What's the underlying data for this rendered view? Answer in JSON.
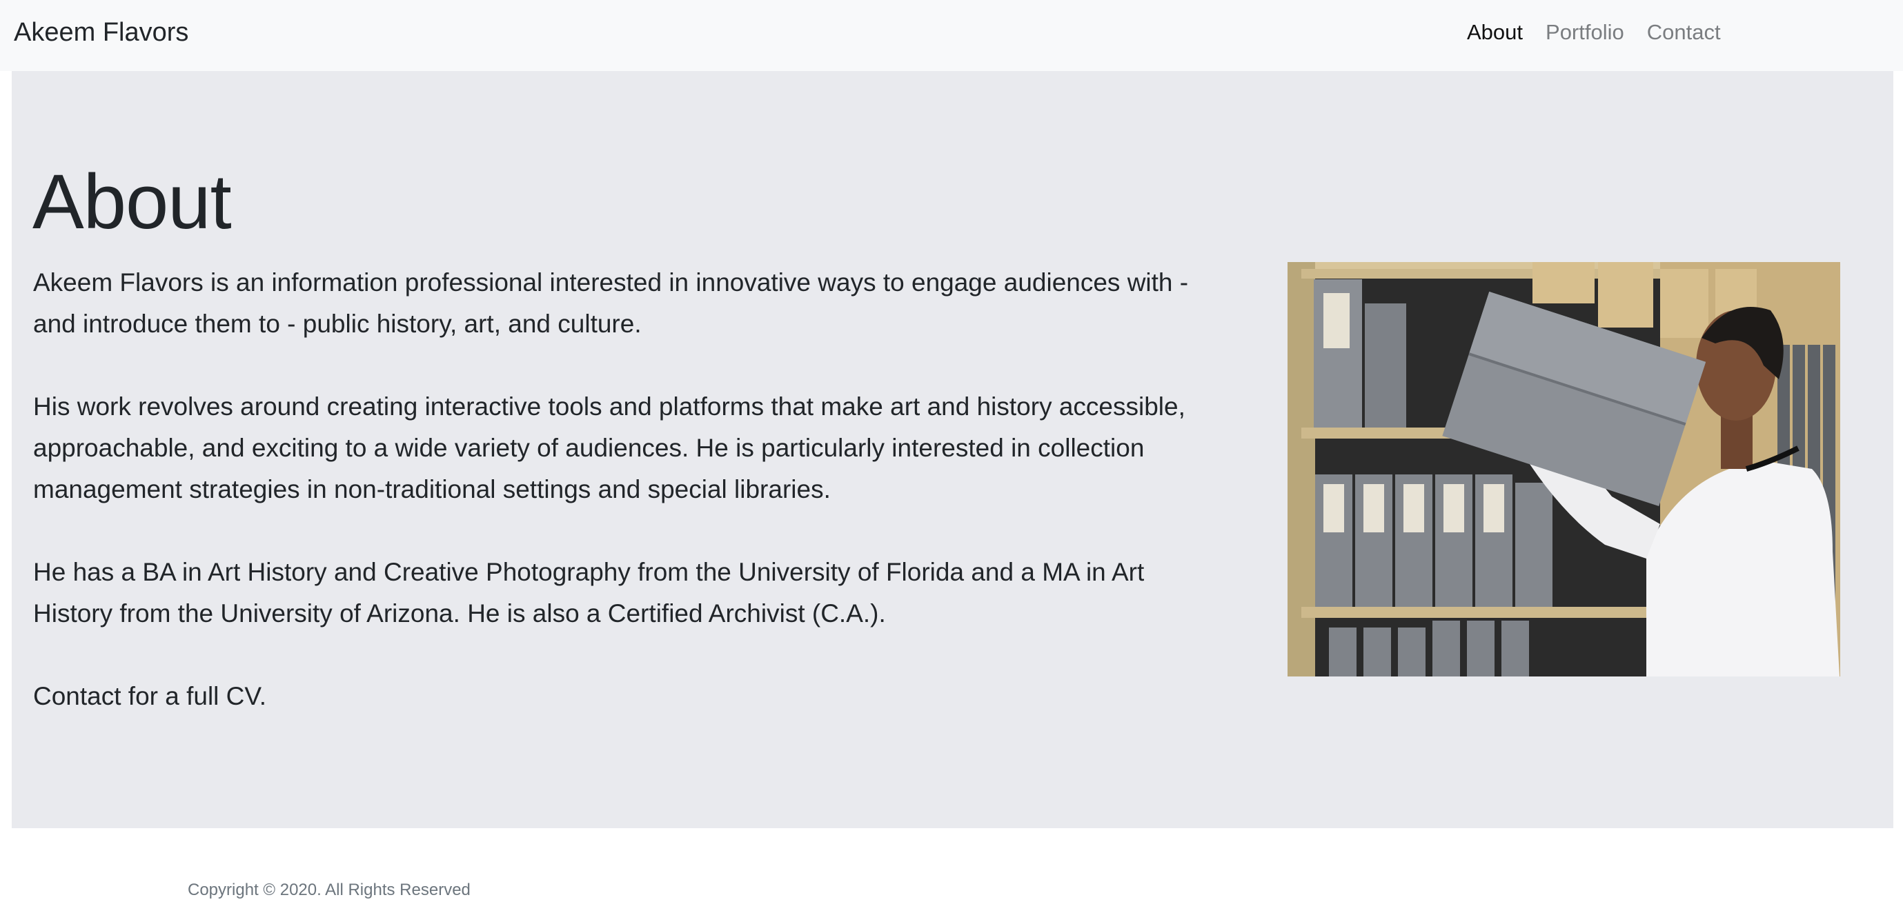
{
  "nav": {
    "brand": "Akeem Flavors",
    "links": [
      {
        "label": "About",
        "active": true
      },
      {
        "label": "Portfolio",
        "active": false
      },
      {
        "label": "Contact",
        "active": false
      }
    ]
  },
  "about": {
    "title": "About",
    "paragraphs": [
      "Akeem Flavors is an information professional interested in innovative ways to engage audiences with - and introduce them to - public history, art, and culture.",
      "His work revolves around creating interactive tools and platforms that make art and history accessible, approachable, and exciting to a wide variety of audiences. He is particularly interested in collection management strategies in non-traditional settings and special libraries.",
      "He has a BA in Art History and Creative Photography from the University of Florida and a MA in Art History from the University of Arizona. He is also a Certified Archivist (C.A.).",
      "Contact for a full CV."
    ]
  },
  "footer": {
    "copyright": "Copyright © 2020. All Rights Reserved"
  },
  "colors": {
    "navbar_bg": "#f8f9fa",
    "jumbotron_bg": "#e9eaee",
    "text": "#212529",
    "muted": "#6c757d"
  }
}
